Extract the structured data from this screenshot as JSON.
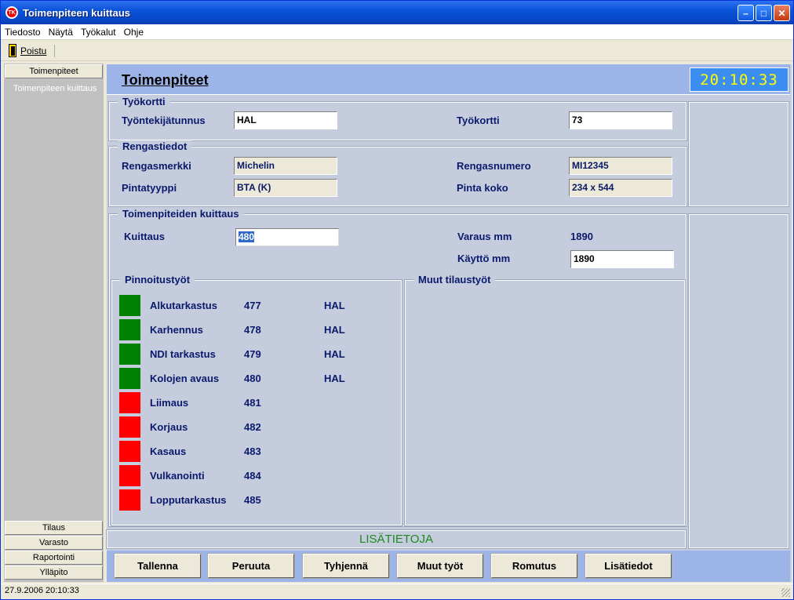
{
  "window": {
    "title": "Toimenpiteen kuittaus",
    "app_icon_text": "TK"
  },
  "menu": [
    "Tiedosto",
    "Näytä",
    "Työkalut",
    "Ohje"
  ],
  "toolbar": {
    "exit_label": "Poistu"
  },
  "sidebar": {
    "top_button": "Toimenpiteet",
    "sub_item": "Toimenpiteen kuittaus",
    "bottom_buttons": [
      "Tilaus",
      "Varasto",
      "Raportointi",
      "Ylläpito"
    ]
  },
  "header": {
    "title": "Toimenpiteet",
    "clock": "20:10:33"
  },
  "tyokortti": {
    "group_title": "Työkortti",
    "employee_label": "Työntekijätunnus",
    "employee_value": "HAL",
    "card_label": "Työkortti",
    "card_value": "73"
  },
  "rengas": {
    "group_title": "Rengastiedot",
    "brand_label": "Rengasmerkki",
    "brand_value": "Michelin",
    "number_label": "Rengasnumero",
    "number_value": "MI12345",
    "tread_label": "Pintatyyppi",
    "tread_value": "BTA (K)",
    "size_label": "Pinta koko",
    "size_value": "234 x 544"
  },
  "kuittaus": {
    "group_title": "Toimenpiteiden kuittaus",
    "kuittaus_label": "Kuittaus",
    "kuittaus_value": "480",
    "varaus_label": "Varaus mm",
    "varaus_value": "1890",
    "kaytto_label": "Käyttö mm",
    "kaytto_value": "1890"
  },
  "pinnoitus": {
    "group_title": "Pinnoitustyöt",
    "colors": {
      "done": "#008000",
      "pending": "#ff0000"
    },
    "operations": [
      {
        "name": "Alkutarkastus",
        "code": "477",
        "user": "HAL",
        "status": "done"
      },
      {
        "name": "Karhennus",
        "code": "478",
        "user": "HAL",
        "status": "done"
      },
      {
        "name": "NDI tarkastus",
        "code": "479",
        "user": "HAL",
        "status": "done"
      },
      {
        "name": "Kolojen avaus",
        "code": "480",
        "user": "HAL",
        "status": "done"
      },
      {
        "name": "Liimaus",
        "code": "481",
        "user": "",
        "status": "pending"
      },
      {
        "name": "Korjaus",
        "code": "482",
        "user": "",
        "status": "pending"
      },
      {
        "name": "Kasaus",
        "code": "483",
        "user": "",
        "status": "pending"
      },
      {
        "name": "Vulkanointi",
        "code": "484",
        "user": "",
        "status": "pending"
      },
      {
        "name": "Lopputarkastus",
        "code": "485",
        "user": "",
        "status": "pending"
      }
    ]
  },
  "muut": {
    "group_title": "Muut tilaustyöt"
  },
  "lisatietoja": "LISÄTIETOJA",
  "actions": [
    "Tallenna",
    "Peruuta",
    "Tyhjennä",
    "Muut työt",
    "Romutus",
    "Lisätiedot"
  ],
  "status": {
    "datetime": "27.9.2006 20:10:33"
  }
}
